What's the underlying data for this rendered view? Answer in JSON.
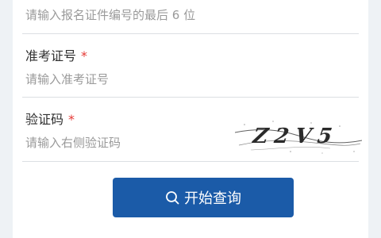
{
  "form": {
    "id_last6": {
      "placeholder": "请输入报名证件编号的最后 6 位"
    },
    "exam_number": {
      "label": "准考证号",
      "required_mark": "*",
      "placeholder": "请输入准考证号"
    },
    "captcha": {
      "label": "验证码",
      "required_mark": "*",
      "placeholder": "请输入右侧验证码",
      "image_text": "Z2V5"
    },
    "submit": {
      "label": "开始查询",
      "icon": "search-icon"
    }
  },
  "colors": {
    "button_bg": "#1b5ba8",
    "required": "#e53935",
    "placeholder": "#9a9a9a",
    "divider": "#dcdfe3",
    "page_bg": "#eef2f5"
  }
}
